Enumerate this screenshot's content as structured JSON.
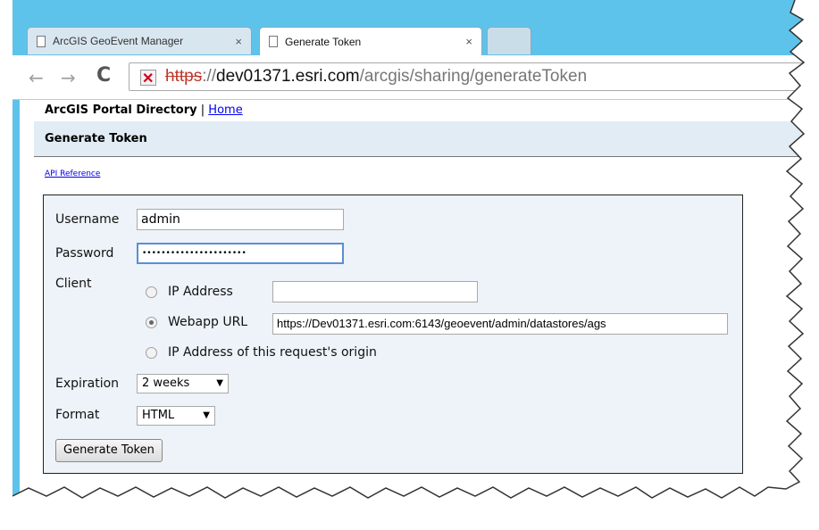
{
  "browser": {
    "tabs": [
      {
        "label": "ArcGIS GeoEvent Manager",
        "active": false
      },
      {
        "label": "Generate Token",
        "active": true
      }
    ],
    "close_glyph": "×",
    "address": {
      "scheme": "https",
      "separator": "://",
      "host": "dev01371.esri.com",
      "path": "/arcgis/sharing/generateToken"
    },
    "icons": {
      "back": "←",
      "forward": "→",
      "reload": "C"
    }
  },
  "page": {
    "portal_title": "ArcGIS Portal Directory",
    "separator": "|",
    "home_link": "Home",
    "section_title": "Generate Token",
    "api_link": "API Reference"
  },
  "form": {
    "username_label": "Username",
    "username_value": "admin",
    "password_label": "Password",
    "password_value": "••••••••••••••••••••••",
    "client_label": "Client",
    "client_options": [
      {
        "label": "IP Address",
        "selected": false,
        "value": ""
      },
      {
        "label": "Webapp URL",
        "selected": true,
        "value": "https://Dev01371.esri.com:6143/geoevent/admin/datastores/ags"
      },
      {
        "label": "IP Address of this request's origin",
        "selected": false
      }
    ],
    "expiration_label": "Expiration",
    "expiration_value": "2 weeks",
    "format_label": "Format",
    "format_value": "HTML",
    "submit_label": "Generate Token"
  },
  "colors": {
    "chrome": "#5ec3ea",
    "title_bar": "#e2ecf4",
    "form_bg": "#edf3f8",
    "link": "#0000ee"
  }
}
